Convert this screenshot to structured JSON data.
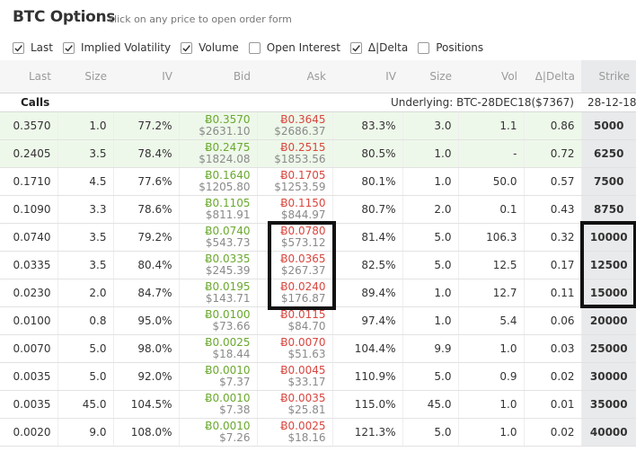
{
  "header": {
    "title": "BTC Options",
    "subtitle": "click on any price to open order form"
  },
  "filters": [
    {
      "label": "Last",
      "checked": true
    },
    {
      "label": "Implied Volatility",
      "checked": true
    },
    {
      "label": "Volume",
      "checked": true
    },
    {
      "label": "Open Interest",
      "checked": false
    },
    {
      "label": "Δ|Delta",
      "checked": true
    },
    {
      "label": "Positions",
      "checked": false
    }
  ],
  "columns": [
    "Last",
    "Size",
    "IV",
    "Bid",
    "Ask",
    "IV",
    "Size",
    "Vol",
    "Δ|Delta",
    "Strike"
  ],
  "calls": {
    "label": "Calls",
    "underlying": "Underlying: BTC-28DEC18($7367)",
    "expiry": "28-12-18"
  },
  "rows": [
    {
      "last": "0.3570",
      "size": "1.0",
      "iv": "77.2%",
      "bid": "Ƀ0.3570",
      "bid_usd": "$2631.10",
      "ask": "Ƀ0.3645",
      "ask_usd": "$2686.37",
      "ask_iv": "83.3%",
      "ask_size": "3.0",
      "vol": "1.1",
      "delta": "0.86",
      "strike": "5000",
      "itm": true
    },
    {
      "last": "0.2405",
      "size": "3.5",
      "iv": "78.4%",
      "bid": "Ƀ0.2475",
      "bid_usd": "$1824.08",
      "ask": "Ƀ0.2515",
      "ask_usd": "$1853.56",
      "ask_iv": "80.5%",
      "ask_size": "1.0",
      "vol": "-",
      "delta": "0.72",
      "strike": "6250",
      "itm": true
    },
    {
      "last": "0.1710",
      "size": "4.5",
      "iv": "77.6%",
      "bid": "Ƀ0.1640",
      "bid_usd": "$1205.80",
      "ask": "Ƀ0.1705",
      "ask_usd": "$1253.59",
      "ask_iv": "80.1%",
      "ask_size": "1.0",
      "vol": "50.0",
      "delta": "0.57",
      "strike": "7500",
      "itm": false
    },
    {
      "last": "0.1090",
      "size": "3.3",
      "iv": "78.6%",
      "bid": "Ƀ0.1105",
      "bid_usd": "$811.91",
      "ask": "Ƀ0.1150",
      "ask_usd": "$844.97",
      "ask_iv": "80.7%",
      "ask_size": "2.0",
      "vol": "0.1",
      "delta": "0.43",
      "strike": "8750",
      "itm": false
    },
    {
      "last": "0.0740",
      "size": "3.5",
      "iv": "79.2%",
      "bid": "Ƀ0.0740",
      "bid_usd": "$543.73",
      "ask": "Ƀ0.0780",
      "ask_usd": "$573.12",
      "ask_iv": "81.4%",
      "ask_size": "5.0",
      "vol": "106.3",
      "delta": "0.32",
      "strike": "10000",
      "itm": false
    },
    {
      "last": "0.0335",
      "size": "3.5",
      "iv": "80.4%",
      "bid": "Ƀ0.0335",
      "bid_usd": "$245.39",
      "ask": "Ƀ0.0365",
      "ask_usd": "$267.37",
      "ask_iv": "82.5%",
      "ask_size": "5.0",
      "vol": "12.5",
      "delta": "0.17",
      "strike": "12500",
      "itm": false
    },
    {
      "last": "0.0230",
      "size": "2.0",
      "iv": "84.7%",
      "bid": "Ƀ0.0195",
      "bid_usd": "$143.71",
      "ask": "Ƀ0.0240",
      "ask_usd": "$176.87",
      "ask_iv": "89.4%",
      "ask_size": "1.0",
      "vol": "12.7",
      "delta": "0.11",
      "strike": "15000",
      "itm": false
    },
    {
      "last": "0.0100",
      "size": "0.8",
      "iv": "95.0%",
      "bid": "Ƀ0.0100",
      "bid_usd": "$73.66",
      "ask": "Ƀ0.0115",
      "ask_usd": "$84.70",
      "ask_iv": "97.4%",
      "ask_size": "1.0",
      "vol": "5.4",
      "delta": "0.06",
      "strike": "20000",
      "itm": false
    },
    {
      "last": "0.0070",
      "size": "5.0",
      "iv": "98.0%",
      "bid": "Ƀ0.0025",
      "bid_usd": "$18.44",
      "ask": "Ƀ0.0070",
      "ask_usd": "$51.63",
      "ask_iv": "104.4%",
      "ask_size": "9.9",
      "vol": "1.0",
      "delta": "0.03",
      "strike": "25000",
      "itm": false
    },
    {
      "last": "0.0035",
      "size": "5.0",
      "iv": "92.0%",
      "bid": "Ƀ0.0010",
      "bid_usd": "$7.37",
      "ask": "Ƀ0.0045",
      "ask_usd": "$33.17",
      "ask_iv": "110.9%",
      "ask_size": "5.0",
      "vol": "0.9",
      "delta": "0.02",
      "strike": "30000",
      "itm": false
    },
    {
      "last": "0.0035",
      "size": "45.0",
      "iv": "104.5%",
      "bid": "Ƀ0.0010",
      "bid_usd": "$7.38",
      "ask": "Ƀ0.0035",
      "ask_usd": "$25.81",
      "ask_iv": "115.0%",
      "ask_size": "45.0",
      "vol": "1.0",
      "delta": "0.01",
      "strike": "35000",
      "itm": false
    },
    {
      "last": "0.0020",
      "size": "9.0",
      "iv": "108.0%",
      "bid": "Ƀ0.0010",
      "bid_usd": "$7.26",
      "ask": "Ƀ0.0025",
      "ask_usd": "$18.16",
      "ask_iv": "121.3%",
      "ask_size": "5.0",
      "vol": "1.0",
      "delta": "0.02",
      "strike": "40000",
      "itm": false
    }
  ],
  "colors": {
    "bid": "#6aa82e",
    "ask": "#d9463e",
    "itm_row": "#eef8ea",
    "strike_col": "#e9eaec",
    "highlight_box": "#111111"
  }
}
